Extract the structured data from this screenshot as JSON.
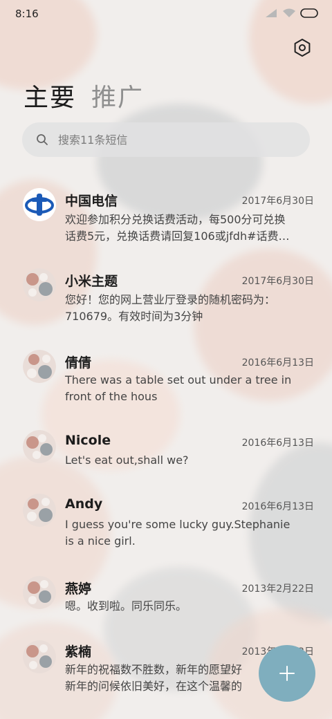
{
  "status": {
    "time": "8:16"
  },
  "tabs": [
    {
      "label": "主要",
      "active": true
    },
    {
      "label": "推广",
      "active": false
    }
  ],
  "search": {
    "placeholder": "搜索11条短信"
  },
  "messages": [
    {
      "sender": "中国电信",
      "date": "2017年6月30日",
      "line1": "欢迎参加积分兑换话费活动，每500分可兑换",
      "line2": "话费5元，兑换话费请回复106或jfdh#话费…",
      "avatar": "telecom-logo"
    },
    {
      "sender": "小米主题",
      "date": "2017年6月30日",
      "line1": "您好！您的网上营业厅登录的随机密码为：",
      "line2": "710679。有效时间为3分钟",
      "avatar": "contact-photo"
    },
    {
      "sender": "倩倩",
      "date": "2016年6月13日",
      "line1": "There was a table set out under a tree in",
      "line2": "front of the hous",
      "avatar": "contact-photo"
    },
    {
      "sender": "Nicole",
      "date": "2016年6月13日",
      "line1": "Let's eat out,shall we?",
      "line2": "",
      "avatar": "contact-photo"
    },
    {
      "sender": "Andy",
      "date": "2016年6月13日",
      "line1": "I guess you're some lucky guy.Stephanie",
      "line2": "is a nice girl.",
      "avatar": "contact-photo"
    },
    {
      "sender": "燕婷",
      "date": "2013年2月22日",
      "line1": "嗯。收到啦。同乐同乐。",
      "line2": "",
      "avatar": "contact-photo"
    },
    {
      "sender": "紫楠",
      "date": "2013年2月22日",
      "line1": "新年的祝福数不胜数，新年的愿望好",
      "line2": "新年的问候依旧美好，在这个温馨的",
      "avatar": "contact-photo"
    }
  ],
  "colors": {
    "accent": "#7faebe",
    "telecom_blue": "#1b5ab7"
  },
  "icons": {
    "settings": "gear-icon",
    "search": "search-icon",
    "compose": "plus-icon"
  }
}
